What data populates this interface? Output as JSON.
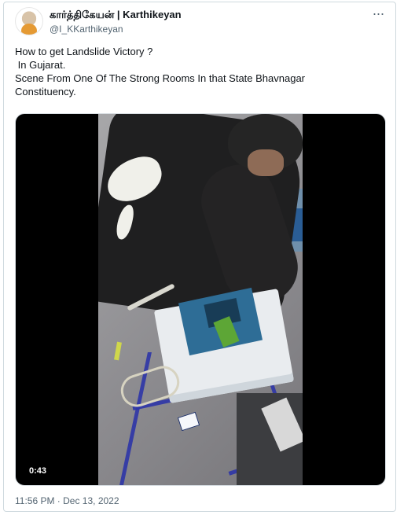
{
  "tweet": {
    "display_name": "கார்த்திகேயன் | Karthikeyan",
    "handle": "@I_KKarthikeyan",
    "lines": [
      "How to get Landslide Victory ?",
      " In Gujarat.",
      "Scene From One Of The Strong Rooms In that State Bhavnagar",
      "Constituency."
    ],
    "video_duration": "0:43",
    "timestamp": "11:56 PM · Dec 13, 2022"
  },
  "icons": {
    "avatar": "profile-avatar",
    "more": "more-icon"
  },
  "colors": {
    "text": "#0f1419",
    "secondary": "#536471",
    "border": "#cfd9de"
  }
}
